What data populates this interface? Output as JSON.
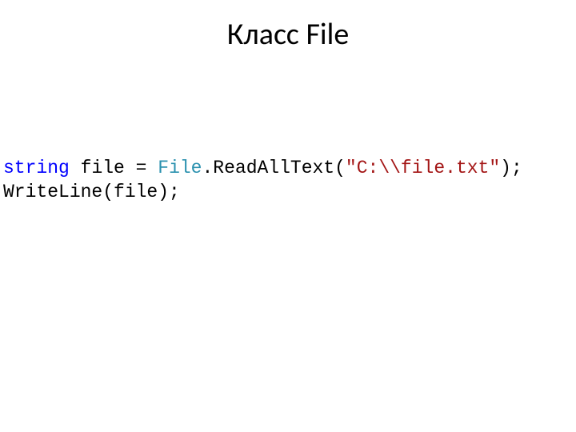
{
  "title": "Класс File",
  "code": {
    "line1": {
      "keyword": "string",
      "space1": " ",
      "var": "file = ",
      "class": "File",
      "method": ".ReadAllText(",
      "string": "\"C:\\\\file.txt\"",
      "end": ");"
    },
    "line2": "WriteLine(file);"
  }
}
